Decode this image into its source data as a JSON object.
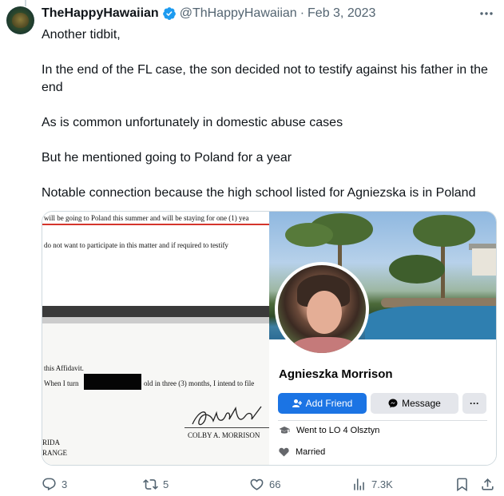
{
  "tweet": {
    "display_name": "TheHappyHawaiian",
    "handle": "@ThHappyHawaiian",
    "separator": "·",
    "date": "Feb 3, 2023",
    "paragraphs": [
      "Another tidbit,",
      "In the end of the FL case, the son decided not to testify against his father in the end",
      "As is common unfortunately in domestic abuse cases",
      "But he mentioned going to Poland for a year",
      "Notable connection because the high school listed for Agniezska is in Poland"
    ]
  },
  "document_image": {
    "line_1": "will be going to Poland this summer and will be staying for one (1) yea",
    "line_2": "do not want to participate in this matter and if required to testify",
    "line_3": "this Affidavit.",
    "line_4_start": "When I turn",
    "line_4_end": "old in three (3) months, I intend to file",
    "signer": "COLBY A. MORRISON",
    "line_5": "RIDA",
    "line_6": "RANGE"
  },
  "facebook_card": {
    "name": "Agnieszka Morrison",
    "add_friend_label": "Add Friend",
    "message_label": "Message",
    "more_label": "···",
    "education": "Went to LO 4 Olsztyn",
    "relationship": "Married"
  },
  "actions": {
    "replies": "3",
    "retweets": "5",
    "likes": "66",
    "views": "7.3K"
  },
  "icons": {
    "verified": "verified-badge-icon",
    "more": "more-dots-icon",
    "reply": "reply-icon",
    "retweet": "retweet-icon",
    "like": "heart-icon",
    "views": "views-chart-icon",
    "bookmark": "bookmark-icon",
    "share": "share-icon"
  },
  "colors": {
    "verified_blue": "#1d9bf0",
    "secondary_text": "#536471",
    "facebook_blue": "#1b74e4"
  }
}
